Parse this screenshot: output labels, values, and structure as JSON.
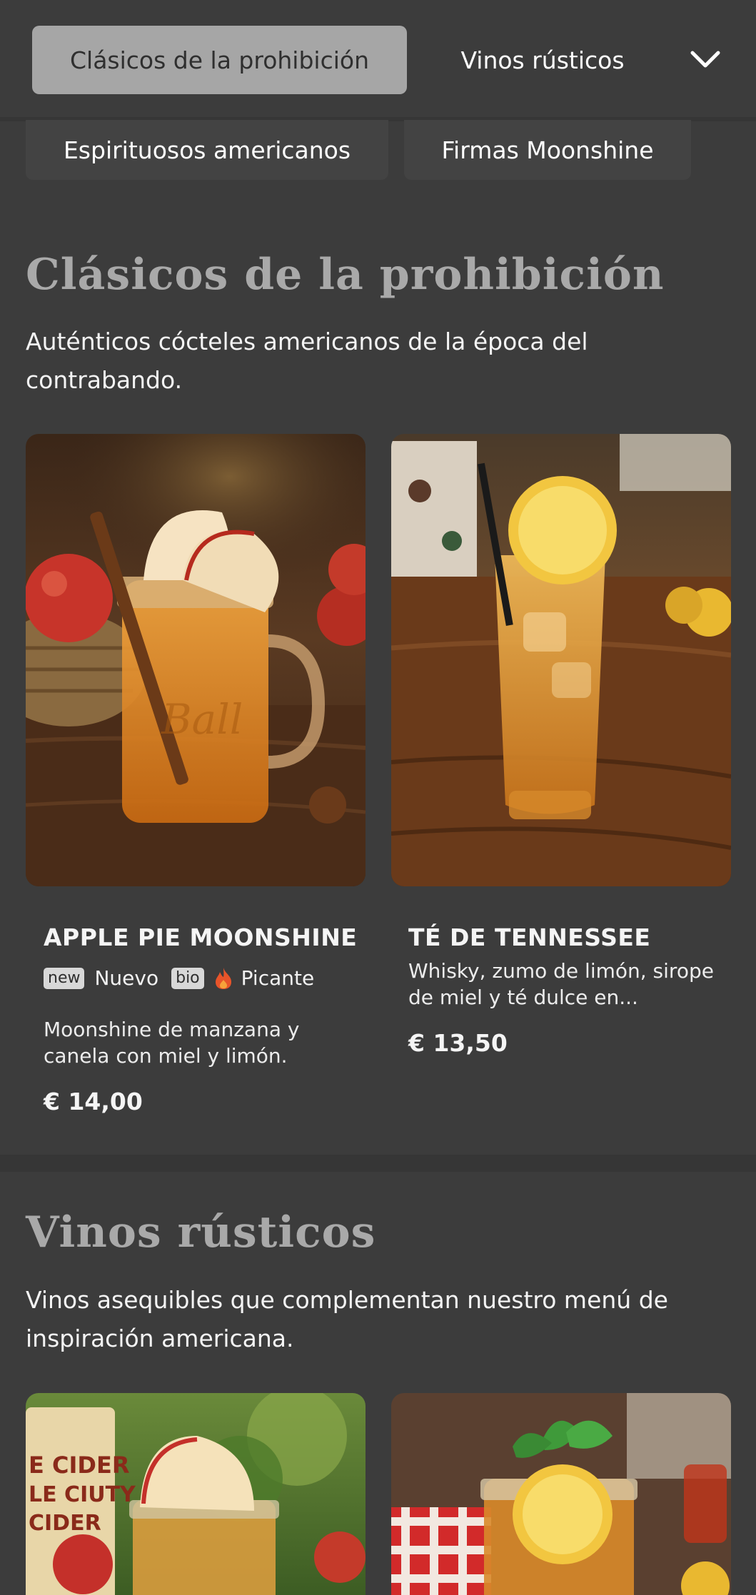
{
  "nav": {
    "active_category": "Clásicos de la prohibición",
    "next_category": "Vinos rústicos",
    "sub_categories": [
      "Espirituosos americanos",
      "Firmas Moonshine"
    ]
  },
  "sections": [
    {
      "title": "Clásicos de la prohibición",
      "description": "Auténticos cócteles americanos de la época del contrabando.",
      "items": [
        {
          "name": "APPLE PIE MOONSHINE",
          "badges": {
            "new_tag": "new",
            "new_label": "Nuevo",
            "bio_tag": "bio",
            "spicy_label": "Picante"
          },
          "description": "Moonshine de manzana y canela con miel y limón.",
          "price": "€ 14,00"
        },
        {
          "name": "TÉ DE TENNESSEE",
          "description": "Whisky, zumo de limón, sirope de miel y té dulce en...",
          "price": "€ 13,50"
        }
      ]
    },
    {
      "title": "Vinos rústicos",
      "description": "Vinos asequibles que complementan nuestro menú de inspiración americana.",
      "image_sign_text": [
        "E CIDER",
        "LE CIUTY",
        "CIDER"
      ]
    }
  ],
  "colors": {
    "background": "#3c3c3c",
    "chip_active": "#a6a6a6",
    "section_title": "#a9a9a9",
    "spicy_flame": "#e8542a"
  },
  "icons": {
    "nav_expand": "chevron-down-icon",
    "spicy": "flame-icon"
  }
}
